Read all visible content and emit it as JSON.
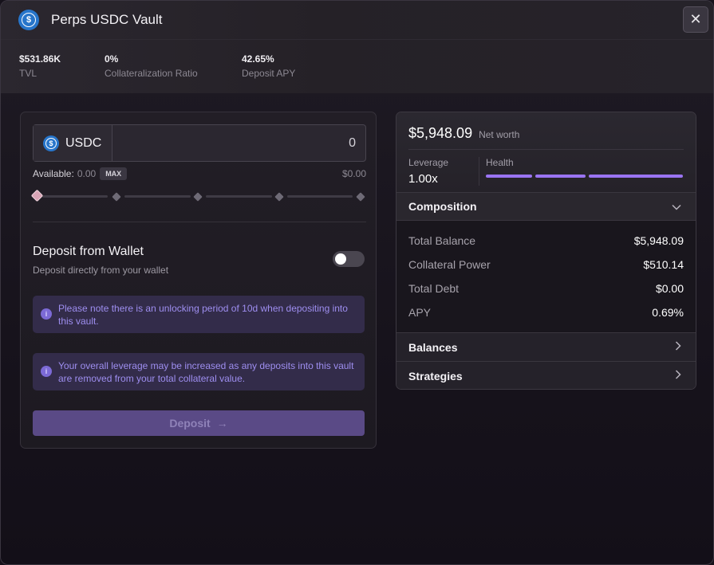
{
  "header": {
    "title": "Perps USDC Vault",
    "close_label": "✕",
    "stats": [
      {
        "value": "$531.86K",
        "label": "TVL"
      },
      {
        "value": "0%",
        "label": "Collateralization Ratio"
      },
      {
        "value": "42.65%",
        "label": "Deposit APY"
      }
    ]
  },
  "deposit": {
    "token": "USDC",
    "amount_value": "0",
    "available_label": "Available:",
    "available_value": "0.00",
    "max_label": "MAX",
    "usd_value": "$0.00",
    "slider_percent": 0,
    "wallet_title": "Deposit from Wallet",
    "wallet_subtitle": "Deposit directly from your wallet",
    "wallet_toggle_on": false,
    "notices": [
      "Please note there is an unlocking period of 10d when depositing into this vault.",
      "Your overall leverage may be increased as any deposits into this vault are removed from your total collateral value."
    ],
    "button_label": "Deposit",
    "button_arrow": "→"
  },
  "account": {
    "net_worth": "$5,948.09",
    "net_worth_label": "Net worth",
    "leverage_label": "Leverage",
    "leverage_value": "1.00x",
    "health_label": "Health",
    "composition_label": "Composition",
    "composition": [
      {
        "label": "Total Balance",
        "value": "$5,948.09"
      },
      {
        "label": "Collateral Power",
        "value": "$510.14"
      },
      {
        "label": "Total Debt",
        "value": "$0.00"
      },
      {
        "label": "APY",
        "value": "0.69%"
      }
    ],
    "balances_label": "Balances",
    "strategies_label": "Strategies"
  },
  "colors": {
    "accent": "#9a74f2",
    "notice_bg": "#332c4a",
    "notice_text": "#9e8ef0",
    "usdc": "#2775ca"
  },
  "icons": {
    "usdc": "usdc-coin-icon",
    "close": "close-icon",
    "info": "info-icon",
    "chevron_down": "chevron-down-icon",
    "chevron_right": "chevron-right-icon",
    "arrow_right": "arrow-right-icon"
  }
}
